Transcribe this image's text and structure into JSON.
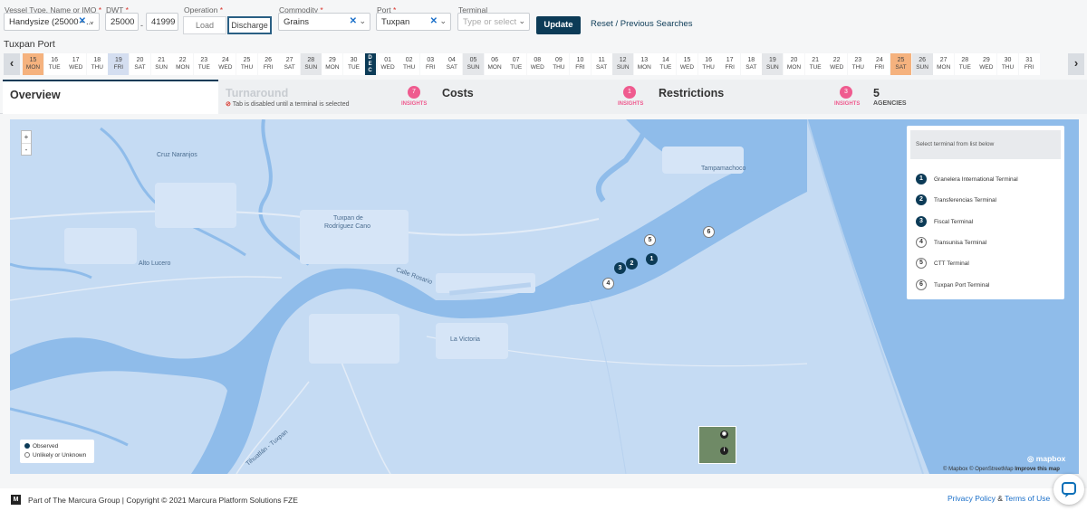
{
  "filters": {
    "vessel": {
      "label": "Vessel Type, Name or IMO",
      "value": "Handysize (25000 - ..."
    },
    "dwt": {
      "label": "DWT",
      "min": "25000",
      "max": "41999",
      "separator": "-"
    },
    "operation": {
      "label": "Operation",
      "options": [
        "Load",
        "Discharge"
      ],
      "selected": "Discharge"
    },
    "commodity": {
      "label": "Commodity",
      "value": "Grains"
    },
    "port": {
      "label": "Port",
      "value": "Tuxpan"
    },
    "terminal": {
      "label": "Terminal",
      "placeholder": "Type or select"
    },
    "required_mark": "*",
    "update_label": "Update",
    "previous_searches_label": "Reset / Previous Searches"
  },
  "port_title": "Tuxpan Port",
  "calendar": {
    "month_marker": "DEC",
    "days": [
      {
        "n": "15",
        "d": "MON",
        "s": "hl"
      },
      {
        "n": "16",
        "d": "TUE"
      },
      {
        "n": "17",
        "d": "WED"
      },
      {
        "n": "18",
        "d": "THU"
      },
      {
        "n": "19",
        "d": "FRI",
        "s": "sel"
      },
      {
        "n": "20",
        "d": "SAT"
      },
      {
        "n": "21",
        "d": "SUN"
      },
      {
        "n": "22",
        "d": "MON"
      },
      {
        "n": "23",
        "d": "TUE"
      },
      {
        "n": "24",
        "d": "WED"
      },
      {
        "n": "25",
        "d": "THU"
      },
      {
        "n": "26",
        "d": "FRI"
      },
      {
        "n": "27",
        "d": "SAT"
      },
      {
        "n": "28",
        "d": "SUN",
        "s": "wk"
      },
      {
        "n": "29",
        "d": "MON"
      },
      {
        "n": "30",
        "d": "TUE"
      },
      {
        "n": "01",
        "d": "WED"
      },
      {
        "n": "02",
        "d": "THU"
      },
      {
        "n": "03",
        "d": "FRI"
      },
      {
        "n": "04",
        "d": "SAT"
      },
      {
        "n": "05",
        "d": "SUN",
        "s": "wk"
      },
      {
        "n": "06",
        "d": "MON"
      },
      {
        "n": "07",
        "d": "TUE"
      },
      {
        "n": "08",
        "d": "WED"
      },
      {
        "n": "09",
        "d": "THU"
      },
      {
        "n": "10",
        "d": "FRI"
      },
      {
        "n": "11",
        "d": "SAT"
      },
      {
        "n": "12",
        "d": "SUN",
        "s": "wk"
      },
      {
        "n": "13",
        "d": "MON"
      },
      {
        "n": "14",
        "d": "TUE"
      },
      {
        "n": "15",
        "d": "WED"
      },
      {
        "n": "16",
        "d": "THU"
      },
      {
        "n": "17",
        "d": "FRI"
      },
      {
        "n": "18",
        "d": "SAT"
      },
      {
        "n": "19",
        "d": "SUN",
        "s": "wk"
      },
      {
        "n": "20",
        "d": "MON"
      },
      {
        "n": "21",
        "d": "TUE"
      },
      {
        "n": "22",
        "d": "WED"
      },
      {
        "n": "23",
        "d": "THU"
      },
      {
        "n": "24",
        "d": "FRI"
      },
      {
        "n": "25",
        "d": "SAT",
        "s": "hl"
      },
      {
        "n": "26",
        "d": "SUN",
        "s": "wk"
      },
      {
        "n": "27",
        "d": "MON"
      },
      {
        "n": "28",
        "d": "TUE"
      },
      {
        "n": "29",
        "d": "WED"
      },
      {
        "n": "30",
        "d": "THU"
      },
      {
        "n": "31",
        "d": "FRI"
      }
    ]
  },
  "tabs": {
    "overview": "Overview",
    "turnaround": {
      "title": "Turnaround",
      "note": "Tab is disabled until a terminal is selected",
      "count": "7",
      "badge_label": "INSIGHTS"
    },
    "costs": {
      "title": "Costs",
      "count": "1",
      "badge_label": "INSIGHTS"
    },
    "restrictions": {
      "title": "Restrictions",
      "count": "3",
      "badge_label": "INSIGHTS"
    },
    "agencies": {
      "count": "5",
      "label": "AGENCIES"
    }
  },
  "map": {
    "zoom_in": "+",
    "zoom_out": "-",
    "terminal_select_placeholder": "Select terminal from list below",
    "terminals": [
      {
        "n": "1",
        "name": "Granelera International Terminal",
        "status": "observed"
      },
      {
        "n": "2",
        "name": "Transferencias Terminal",
        "status": "observed"
      },
      {
        "n": "3",
        "name": "Fiscal Terminal",
        "status": "observed"
      },
      {
        "n": "4",
        "name": "Transunisa Terminal",
        "status": "unknown"
      },
      {
        "n": "5",
        "name": "CTT Terminal",
        "status": "unknown"
      },
      {
        "n": "6",
        "name": "Tuxpan Port Terminal",
        "status": "unknown"
      }
    ],
    "places": {
      "cruz": "Cruz Naranjos",
      "tampa": "Tampamachoco",
      "tuxpan": "Tuxpan de",
      "tuxpan2": "Rodríguez Cano",
      "alto": "Alto Lucero",
      "victoria": "La Victoria",
      "rosario": "Calle Rosario",
      "tuxpan_road": "Tihuatlán - Tuxpan"
    },
    "legend": {
      "observed": "Observed",
      "unknown": "Unlikely or Unknown"
    },
    "mapbox_logo": "mapbox",
    "attribution": "© Mapbox © OpenStreetMap",
    "improve": "Improve this map",
    "colors": {
      "water": "#8fbcea",
      "land": "#c5dbf3",
      "observed": "#0c3b57"
    }
  },
  "footer": {
    "logo": "M",
    "copyright": "Part of The Marcura Group | Copyright © 2021 Marcura Platform Solutions FZE",
    "privacy": "Privacy Policy",
    "amp": "&",
    "terms": "Terms of Use"
  }
}
